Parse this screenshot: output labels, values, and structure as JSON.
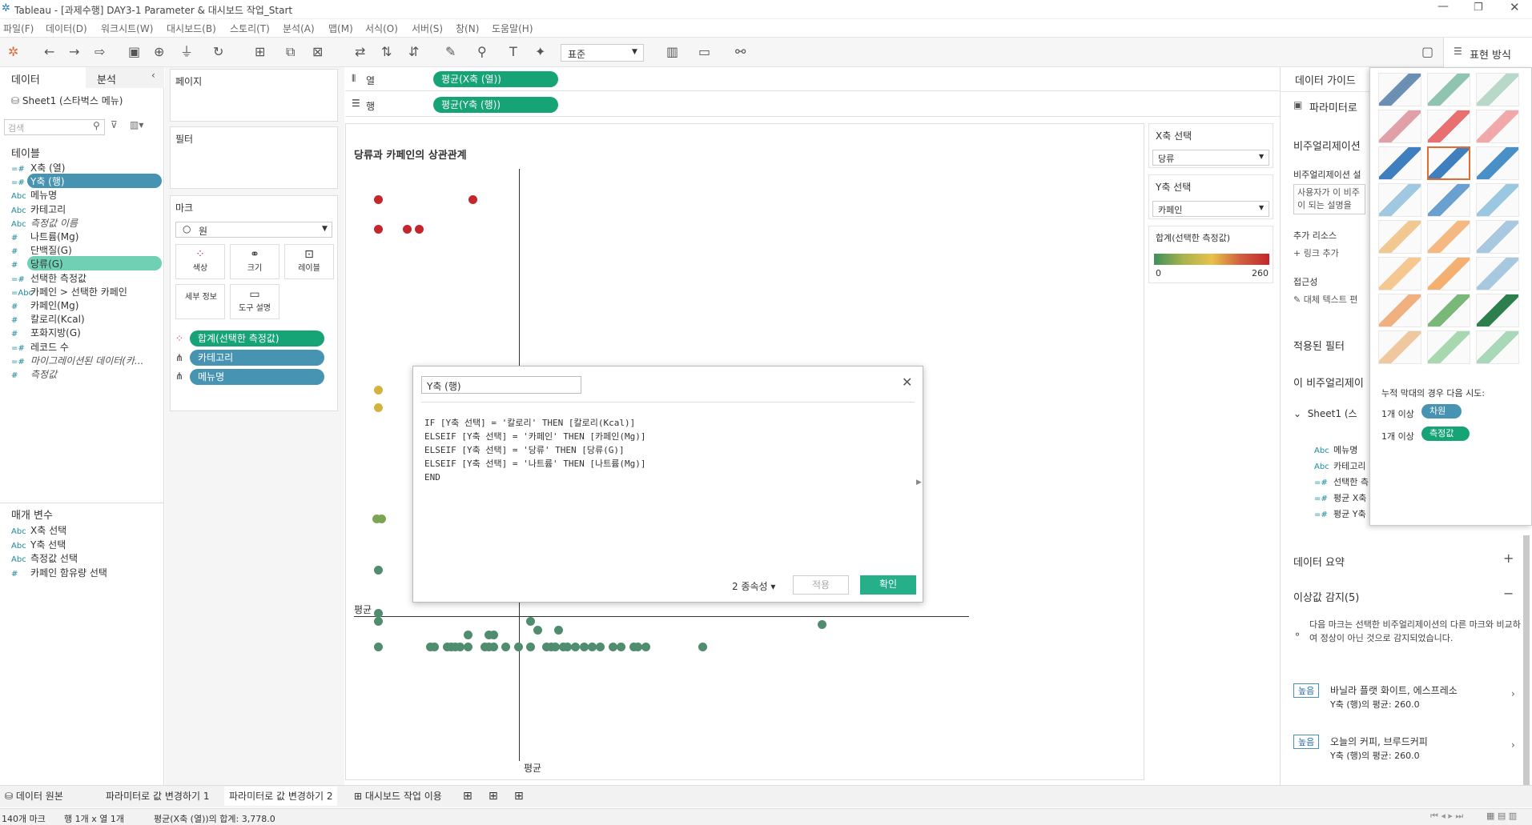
{
  "window": {
    "title": "Tableau - [과제수행] DAY3-1 Parameter & 대시보드 작업_Start"
  },
  "menu": [
    "파일(F)",
    "데이터(D)",
    "워크시트(W)",
    "대시보드(B)",
    "스토리(T)",
    "분석(A)",
    "맵(M)",
    "서식(O)",
    "서버(S)",
    "창(N)",
    "도움말(H)"
  ],
  "toolbar": {
    "fit_select": "표준",
    "show_me_label": "표현 방식"
  },
  "left_panel": {
    "tab_data": "데이터",
    "tab_analysis": "분석",
    "datasource": "Sheet1 (스타벅스 메뉴)",
    "search_placeholder": "검색",
    "tables_header": "테이블",
    "fields": [
      {
        "type": "=#",
        "name": "X축 (열)"
      },
      {
        "type": "=#",
        "name": "Y축 (행)"
      },
      {
        "type": "Abc",
        "name": "메뉴명"
      },
      {
        "type": "Abc",
        "name": "카테고리"
      },
      {
        "type": "Abc",
        "name": "측정값 이름"
      },
      {
        "type": "#",
        "name": "나트륨(Mg)"
      },
      {
        "type": "#",
        "name": "단백질(G)"
      },
      {
        "type": "#",
        "name": "당류(G)"
      },
      {
        "type": "=#",
        "name": "선택한 측정값"
      },
      {
        "type": "=Abc",
        "name": "카페인 > 선택한 카페인"
      },
      {
        "type": "#",
        "name": "카페인(Mg)"
      },
      {
        "type": "#",
        "name": "칼로리(Kcal)"
      },
      {
        "type": "#",
        "name": "포화지방(G)"
      },
      {
        "type": "=#",
        "name": "레코드 수"
      },
      {
        "type": "=#",
        "name": "마이그레이션된 데이터(카..."
      },
      {
        "type": "#",
        "name": "측정값"
      }
    ],
    "params_header": "매개 변수",
    "params": [
      {
        "type": "Abc",
        "name": "X축 선택"
      },
      {
        "type": "Abc",
        "name": "Y축 선택"
      },
      {
        "type": "Abc",
        "name": "측정값 선택"
      },
      {
        "type": "#",
        "name": "카페인 함유량 선택"
      }
    ]
  },
  "cards": {
    "pages": "페이지",
    "filters": "필터",
    "marks": "마크",
    "mark_type": "원",
    "mark_buttons": [
      "색상",
      "크기",
      "레이블",
      "세부 정보",
      "도구 설명"
    ],
    "mark_pills": [
      "합계(선택한 측정값)",
      "카테고리",
      "메뉴명"
    ]
  },
  "shelves": {
    "columns_label": "열",
    "rows_label": "행",
    "columns_pill": "평균(X축 (열))",
    "rows_pill": "평균(Y축 (행))"
  },
  "viz": {
    "title": "당류과 카페인의 상관관계",
    "avg_label_y": "평균",
    "avg_label_x": "평균"
  },
  "param_controls": {
    "x_title": "X축 선택",
    "x_value": "당류",
    "y_title": "Y축 선택",
    "y_value": "카페인",
    "legend_title": "합계(선택한 측정값)",
    "legend_min": "0",
    "legend_max": "260"
  },
  "calc_dialog": {
    "name": "Y축 (행)",
    "lines": [
      "IF [Y축 선택] = '칼로리' THEN [칼로리(Kcal)]",
      "ELSEIF [Y축 선택] = '카페인' THEN [카페인(Mg)]",
      "ELSEIF [Y축 선택] = '당류' THEN [당류(G)]",
      "ELSEIF [Y축 선택] = '나트륨' THEN [나트륨(Mg)]",
      "END"
    ],
    "dependencies": "2 종속성",
    "apply": "적용",
    "ok": "확인"
  },
  "data_guide": {
    "title": "데이터 가이드",
    "parameter_label": "파라미터로",
    "viz_header": "비주얼리제이션",
    "viz_desc_label": "비주얼리제이션 설",
    "viz_desc_text": "사용자가 이 비주 이 되는 설명을 입",
    "add_resource": "추가 리소스",
    "add_link": "링크 추가",
    "accessibility": "접근성",
    "alt_text": "대체 텍스트 편",
    "applied_filters": "적용된 필터",
    "this_viz": "이 비주얼리제이",
    "sheet_item": "Sheet1 (스",
    "fields": [
      {
        "type": "Abc",
        "name": "메뉴명"
      },
      {
        "type": "Abc",
        "name": "카테고리"
      },
      {
        "type": "=#",
        "name": "선택한 측"
      },
      {
        "type": "=#",
        "name": "평균 X축"
      },
      {
        "type": "=#",
        "name": "평균 Y축"
      }
    ],
    "data_summary": "데이터 요약",
    "outliers": "이상값 감지(5)",
    "outlier_desc": "다음 마크는 선택한 비주얼리제이션의 다른 마크와 비교하여 정상이 아닌 것으로 감지되었습니다.",
    "outlier_items": [
      {
        "badge": "높음",
        "title": "바닐라 플랫 화이트, 에스프레소",
        "sub": "Y축 (행)의 평균: 260.0"
      },
      {
        "badge": "높음",
        "title": "오늘의 커피, 브루드커피",
        "sub": "Y축 (행)의 평균: 260.0"
      }
    ]
  },
  "show_me": {
    "hint": "누적 막대의 경우 다음 시도:",
    "dim_prefix": "1개 이상",
    "dim": "차원",
    "meas_prefix": "1개 이상",
    "meas": "측정값"
  },
  "tabs": [
    "데이터 원본",
    "파라미터로 값 변경하기 1",
    "파라미터로 값 변경하기 2",
    "대시보드 작업 이용"
  ],
  "status": {
    "marks": "140개 마크",
    "rows_cols": "행 1개 x 열 1개",
    "sum": "평균(X축 (열))의 합계: 3,778.0"
  },
  "colors": {
    "green_pill": "#16a477",
    "blue_pill": "#4794b2",
    "accent": "#1f9f8a"
  },
  "chart_data": {
    "type": "scatter",
    "title": "당류과 카페인의 상관관계",
    "xlabel": "평균",
    "ylabel": "평균",
    "legend": {
      "title": "합계(선택한 측정값)",
      "range": [
        0,
        260
      ]
    }
  }
}
